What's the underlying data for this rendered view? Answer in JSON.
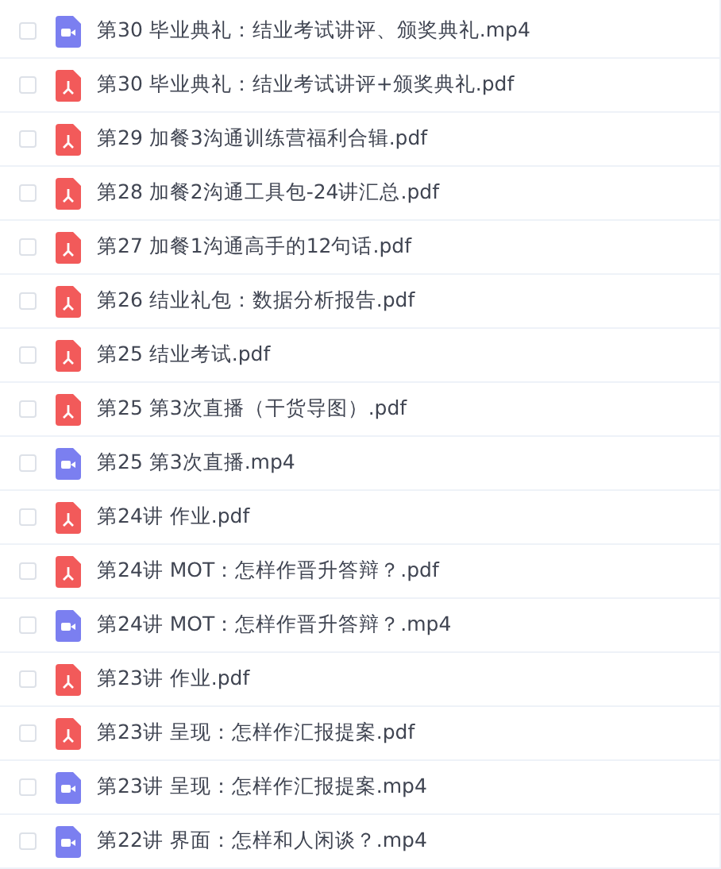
{
  "files": [
    {
      "kind": "video",
      "name": "第30 毕业典礼：结业考试讲评、颁奖典礼.mp4",
      "checked": false
    },
    {
      "kind": "pdf",
      "name": "第30 毕业典礼：结业考试讲评+颁奖典礼.pdf",
      "checked": false
    },
    {
      "kind": "pdf",
      "name": "第29 加餐3沟通训练营福利合辑.pdf",
      "checked": false
    },
    {
      "kind": "pdf",
      "name": "第28 加餐2沟通工具包-24讲汇总.pdf",
      "checked": false
    },
    {
      "kind": "pdf",
      "name": "第27 加餐1沟通高手的12句话.pdf",
      "checked": false
    },
    {
      "kind": "pdf",
      "name": "第26 结业礼包：数据分析报告.pdf",
      "checked": false
    },
    {
      "kind": "pdf",
      "name": "第25 结业考试.pdf",
      "checked": false
    },
    {
      "kind": "pdf",
      "name": "第25 第3次直播（干货导图）.pdf",
      "checked": false
    },
    {
      "kind": "video",
      "name": "第25 第3次直播.mp4",
      "checked": false
    },
    {
      "kind": "pdf",
      "name": "第24讲 作业.pdf",
      "checked": false
    },
    {
      "kind": "pdf",
      "name": "第24讲 MOT：怎样作晋升答辩？.pdf",
      "checked": false
    },
    {
      "kind": "video",
      "name": "第24讲 MOT：怎样作晋升答辩？.mp4",
      "checked": false
    },
    {
      "kind": "pdf",
      "name": "第23讲 作业.pdf",
      "checked": false
    },
    {
      "kind": "pdf",
      "name": "第23讲 呈现：怎样作汇报提案.pdf",
      "checked": false
    },
    {
      "kind": "video",
      "name": "第23讲 呈现：怎样作汇报提案.mp4",
      "checked": false
    },
    {
      "kind": "video",
      "name": "第22讲 界面：怎样和人闲谈？.mp4",
      "checked": false
    }
  ]
}
